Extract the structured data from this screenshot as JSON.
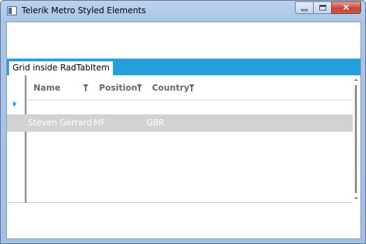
{
  "window": {
    "title": "Telerik Metro Styled Elements",
    "icons": {
      "app": "window-app-icon",
      "minimize": "minimize-icon",
      "maximize": "maximize-icon",
      "close": "close-icon"
    },
    "close_glyph": "✕"
  },
  "tabs": [
    {
      "label": "Grid inside RadTabItem",
      "selected": true
    }
  ],
  "grid": {
    "columns": [
      {
        "header": "Name",
        "filter_icon": "filter-icon"
      },
      {
        "header": "Position",
        "filter_icon": "filter-icon"
      },
      {
        "header": "Country",
        "filter_icon": "filter-icon"
      }
    ],
    "rows": [
      {
        "name": "Steven Gerrard",
        "position": "MF",
        "country": "GBR",
        "selected": true
      }
    ],
    "current_row_marker": "row-indicator-arrow-icon"
  },
  "colors": {
    "accent": "#25a0da",
    "selected_row": "#d3d2d2",
    "header_text": "#6a6a6a"
  }
}
